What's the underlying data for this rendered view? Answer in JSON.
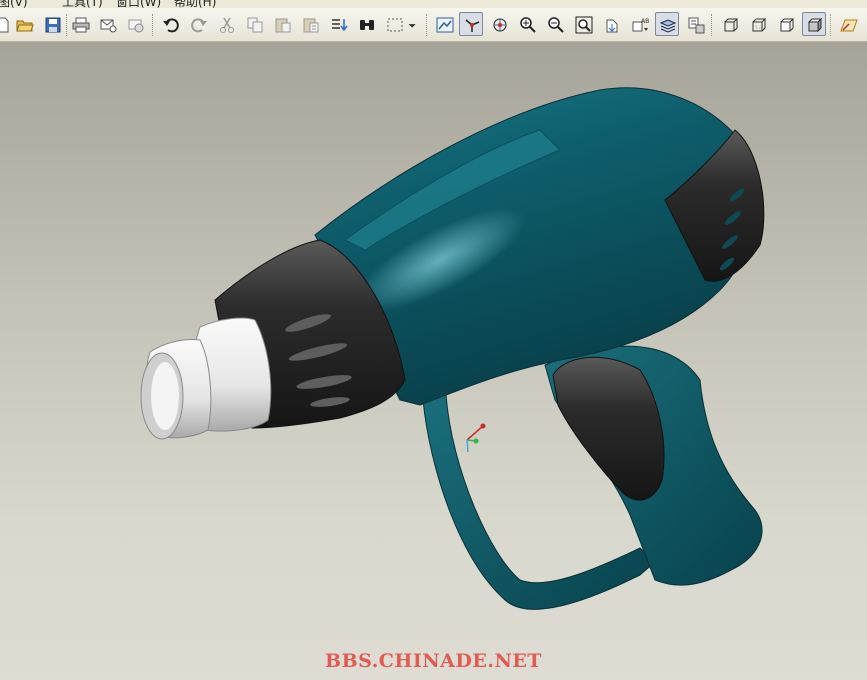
{
  "menubar": {
    "items": [
      "视图(V)",
      "工具(T)",
      "窗口(W)",
      "帮助(H)"
    ]
  },
  "toolbar": {
    "buttons": [
      {
        "name": "new-icon"
      },
      {
        "name": "open-icon"
      },
      {
        "name": "save-icon"
      },
      {
        "name": "print-icon"
      },
      {
        "name": "send-mail-icon"
      },
      {
        "name": "send-link-icon"
      },
      {
        "name": "undo-icon"
      },
      {
        "name": "redo-icon"
      },
      {
        "name": "cut-icon"
      },
      {
        "name": "copy-icon"
      },
      {
        "name": "paste-icon"
      },
      {
        "name": "paste-special-icon"
      },
      {
        "name": "regenerate-icon"
      },
      {
        "name": "find-icon"
      },
      {
        "name": "select-box-icon"
      },
      {
        "name": "dropdown-arrow-icon"
      },
      {
        "name": "repaint-icon"
      },
      {
        "name": "spin-center-icon"
      },
      {
        "name": "orient-mode-icon"
      },
      {
        "name": "zoom-in-icon"
      },
      {
        "name": "zoom-out-icon"
      },
      {
        "name": "refit-icon"
      },
      {
        "name": "reorient-icon"
      },
      {
        "name": "saved-views-icon"
      },
      {
        "name": "layers-icon"
      },
      {
        "name": "model-tree-icon"
      },
      {
        "name": "wireframe-icon"
      },
      {
        "name": "hidden-line-icon"
      },
      {
        "name": "no-hidden-icon"
      },
      {
        "name": "shading-icon"
      },
      {
        "name": "datum-planes-icon"
      }
    ],
    "active": [
      "spin-center-icon",
      "layers-icon",
      "shading-icon"
    ]
  },
  "colors": {
    "body": "#0d5a66",
    "grip": "#2b2b2b",
    "nozzle": "#e8e8e8",
    "watermark": "#e25b52"
  },
  "watermark": {
    "text": "BBS.CHINADE.NET"
  }
}
